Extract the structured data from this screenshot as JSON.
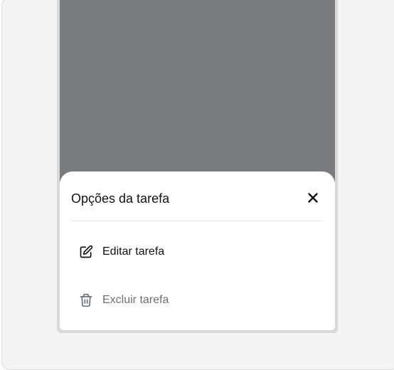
{
  "sheet": {
    "title": "Opções da tarefa",
    "close_icon": "close-icon",
    "items": [
      {
        "label": "Editar tarefa",
        "icon": "edit-icon",
        "color": "#111111"
      },
      {
        "label": "Excluir tarefa",
        "icon": "trash-icon",
        "color": "#6b6f76"
      }
    ]
  },
  "colors": {
    "overlay": "#7a7b7c",
    "sheet_background": "#ffffff",
    "page_background": "#f4f4f4"
  }
}
